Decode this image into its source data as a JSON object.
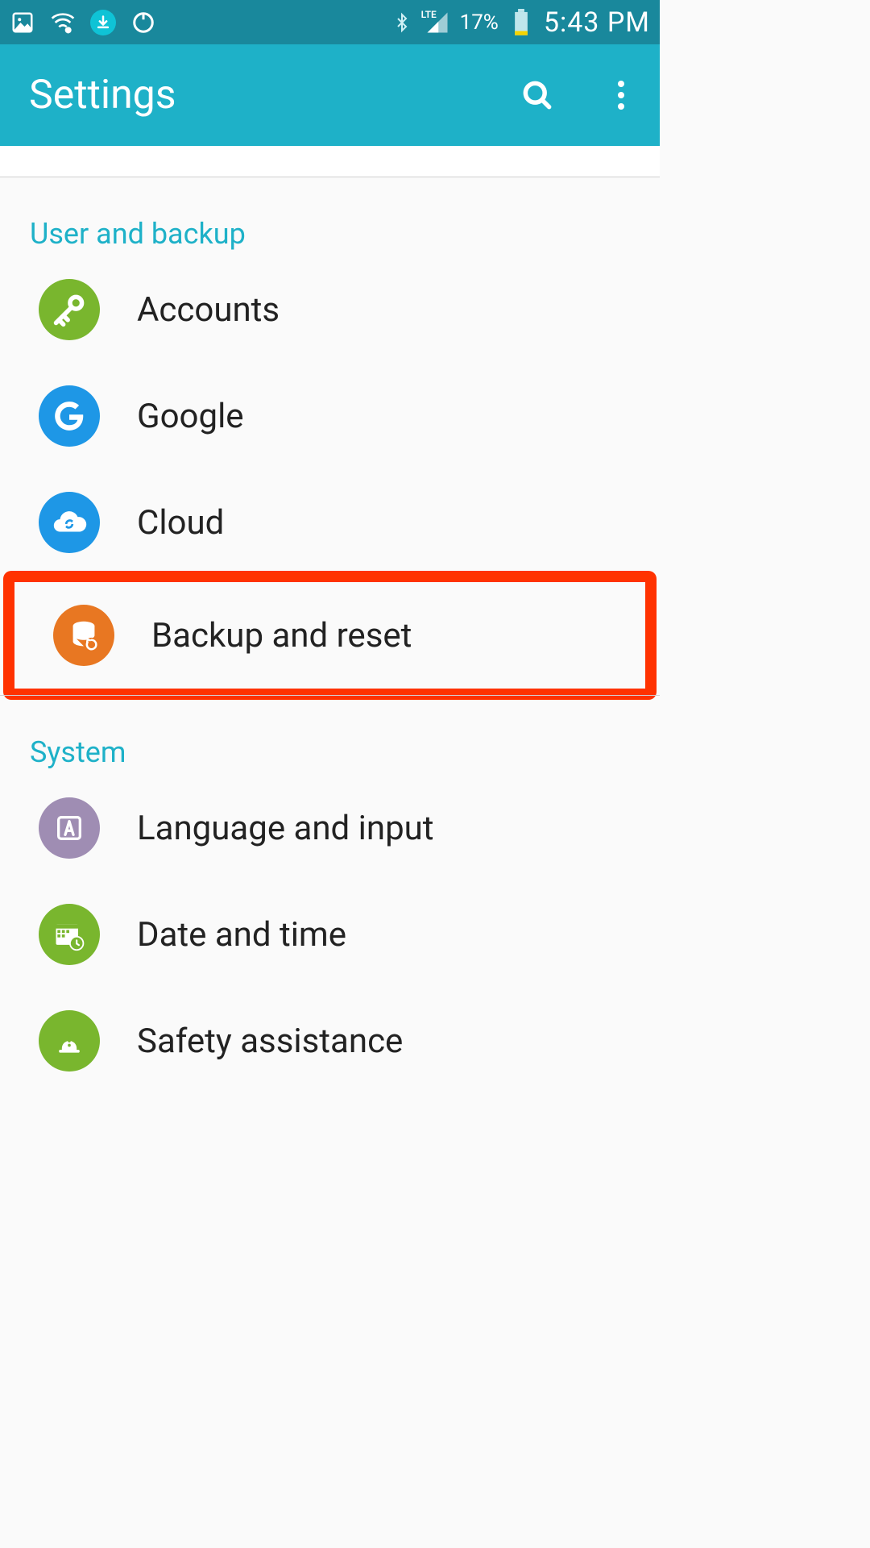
{
  "status": {
    "battery_text": "17%",
    "clock": "5:43 PM",
    "lte_label": "LTE"
  },
  "appbar": {
    "title": "Settings"
  },
  "sections": [
    {
      "title": "User and backup",
      "items": [
        {
          "label": "Accounts",
          "icon": "key",
          "color": "#79b62e"
        },
        {
          "label": "Google",
          "icon": "google-g",
          "color": "#1e97e6"
        },
        {
          "label": "Cloud",
          "icon": "cloud",
          "color": "#1e97e6"
        },
        {
          "label": "Backup and reset",
          "icon": "database",
          "color": "#e87722",
          "highlighted": true
        }
      ]
    },
    {
      "title": "System",
      "items": [
        {
          "label": "Language and input",
          "icon": "letter-a",
          "color": "#9f8db3"
        },
        {
          "label": "Date and time",
          "icon": "calendar",
          "color": "#79b62e"
        },
        {
          "label": "Safety assistance",
          "icon": "alert",
          "color": "#79b62e"
        }
      ]
    }
  ]
}
